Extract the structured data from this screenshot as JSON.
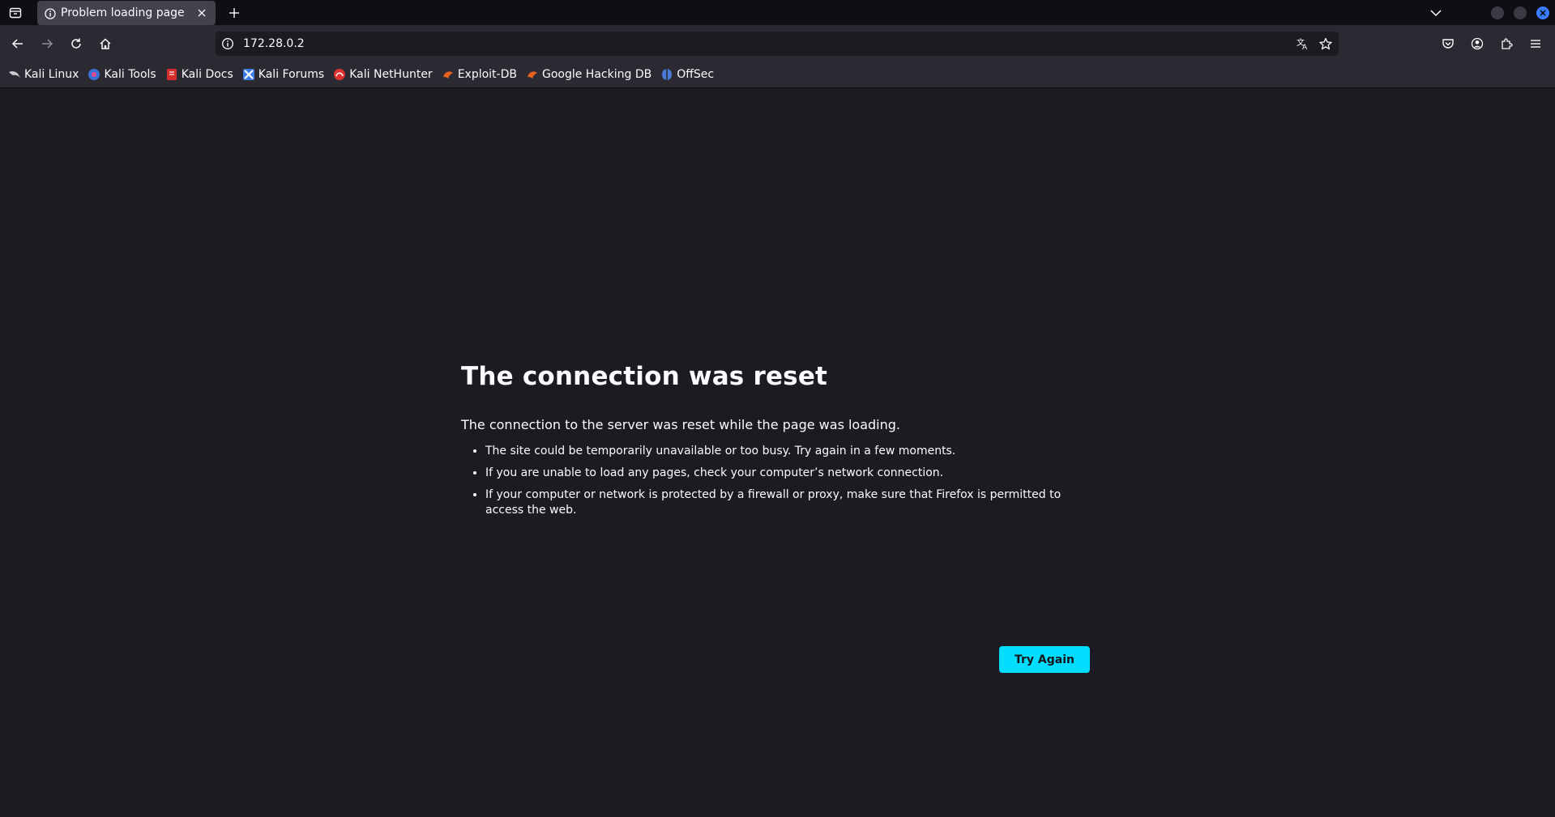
{
  "tab": {
    "title": "Problem loading page"
  },
  "navbar": {
    "url": "172.28.0.2"
  },
  "bookmarks": [
    {
      "label": "Kali Linux",
      "icon": "kali-dragon-icon",
      "color": "#1d1d1d"
    },
    {
      "label": "Kali Tools",
      "icon": "kali-tools-icon",
      "color": "#3b6fd8"
    },
    {
      "label": "Kali Docs",
      "icon": "kali-docs-icon",
      "color": "#d42b2b"
    },
    {
      "label": "Kali Forums",
      "icon": "kali-forums-icon",
      "color": "#3d7de0"
    },
    {
      "label": "Kali NetHunter",
      "icon": "kali-nethunter-icon",
      "color": "#e03030"
    },
    {
      "label": "Exploit-DB",
      "icon": "exploit-db-icon",
      "color": "#e8601c"
    },
    {
      "label": "Google Hacking DB",
      "icon": "google-hacking-db-icon",
      "color": "#e8601c"
    },
    {
      "label": "OffSec",
      "icon": "offsec-icon",
      "color": "#4a7ad8"
    }
  ],
  "error": {
    "title": "The connection was reset",
    "description": "The connection to the server was reset while the page was loading.",
    "items": [
      "The site could be temporarily unavailable or too busy. Try again in a few moments.",
      "If you are unable to load any pages, check your computer’s network connection.",
      "If your computer or network is protected by a firewall or proxy, make sure that Firefox is permitted to access the web."
    ],
    "button_label": "Try Again"
  },
  "colors": {
    "accent": "#00ddff",
    "content_bg": "#1c1b22",
    "toolbar_bg": "#2b2a33",
    "tabstrip_bg": "#0f0f13"
  }
}
